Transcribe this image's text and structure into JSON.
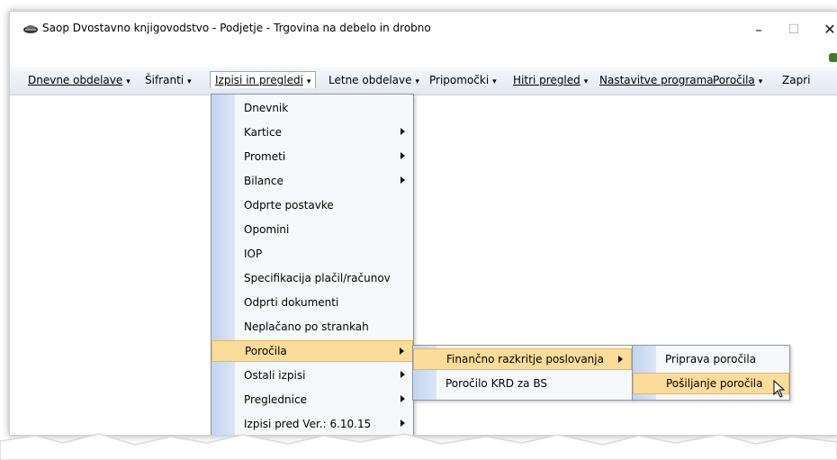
{
  "window": {
    "title": "Saop Dvostavno knjigovodstvo - Podjetje - Trgovina na debelo in drobno",
    "minimize": "–",
    "maximize": "☐",
    "close": "✕"
  },
  "menubar": {
    "items": [
      {
        "label": "Dnevne obdelave",
        "has_dropdown": true
      },
      {
        "label": "Šifranti",
        "has_dropdown": true
      },
      {
        "label": "Izpisi in pregledi",
        "has_dropdown": true,
        "active": true
      },
      {
        "label": "Letne obdelave",
        "has_dropdown": true
      },
      {
        "label": "Pripomočki",
        "has_dropdown": true
      },
      {
        "label": "Hitri pregled",
        "has_dropdown": true
      },
      {
        "label": "Nastavitve programa",
        "has_dropdown": false
      },
      {
        "label": "Poročila",
        "has_dropdown": true
      },
      {
        "label": "Zapri",
        "has_dropdown": false
      }
    ],
    "dropdown_arrow": "▾"
  },
  "menu_izpisi": {
    "items": [
      {
        "label": "Dnevnik",
        "submenu": false
      },
      {
        "label": "Kartice",
        "submenu": true
      },
      {
        "label": "Prometi",
        "submenu": true
      },
      {
        "label": "Bilance",
        "submenu": true
      },
      {
        "label": "Odprte postavke",
        "submenu": false
      },
      {
        "label": "Opomini",
        "submenu": false
      },
      {
        "label": "IOP",
        "submenu": false
      },
      {
        "label": "Specifikacija plačil/računov",
        "submenu": false
      },
      {
        "label": "Odprti dokumenti",
        "submenu": false
      },
      {
        "label": "Neplačano po strankah",
        "submenu": false
      },
      {
        "label": "Poročila",
        "submenu": true,
        "highlighted": true
      },
      {
        "label": "Ostali izpisi",
        "submenu": true
      },
      {
        "label": "Preglednice",
        "submenu": true
      },
      {
        "label": "Izpisi pred Ver.: 6.10.15",
        "submenu": true
      }
    ]
  },
  "menu_porocila": {
    "items": [
      {
        "label": "Finančno razkritje poslovanja",
        "submenu": true,
        "highlighted": true
      },
      {
        "label": "Poročilo KRD za BS",
        "submenu": false
      }
    ]
  },
  "menu_financno": {
    "items": [
      {
        "label": "Priprava poročila",
        "submenu": false
      },
      {
        "label": "Pošiljanje poročila",
        "submenu": false,
        "highlighted": true
      }
    ]
  },
  "colors": {
    "highlight": "#fcdc9a",
    "highlight_border": "#e3b55a",
    "menu_strip": "#c4d4ef",
    "menubar_bg": "#e9eef5"
  }
}
